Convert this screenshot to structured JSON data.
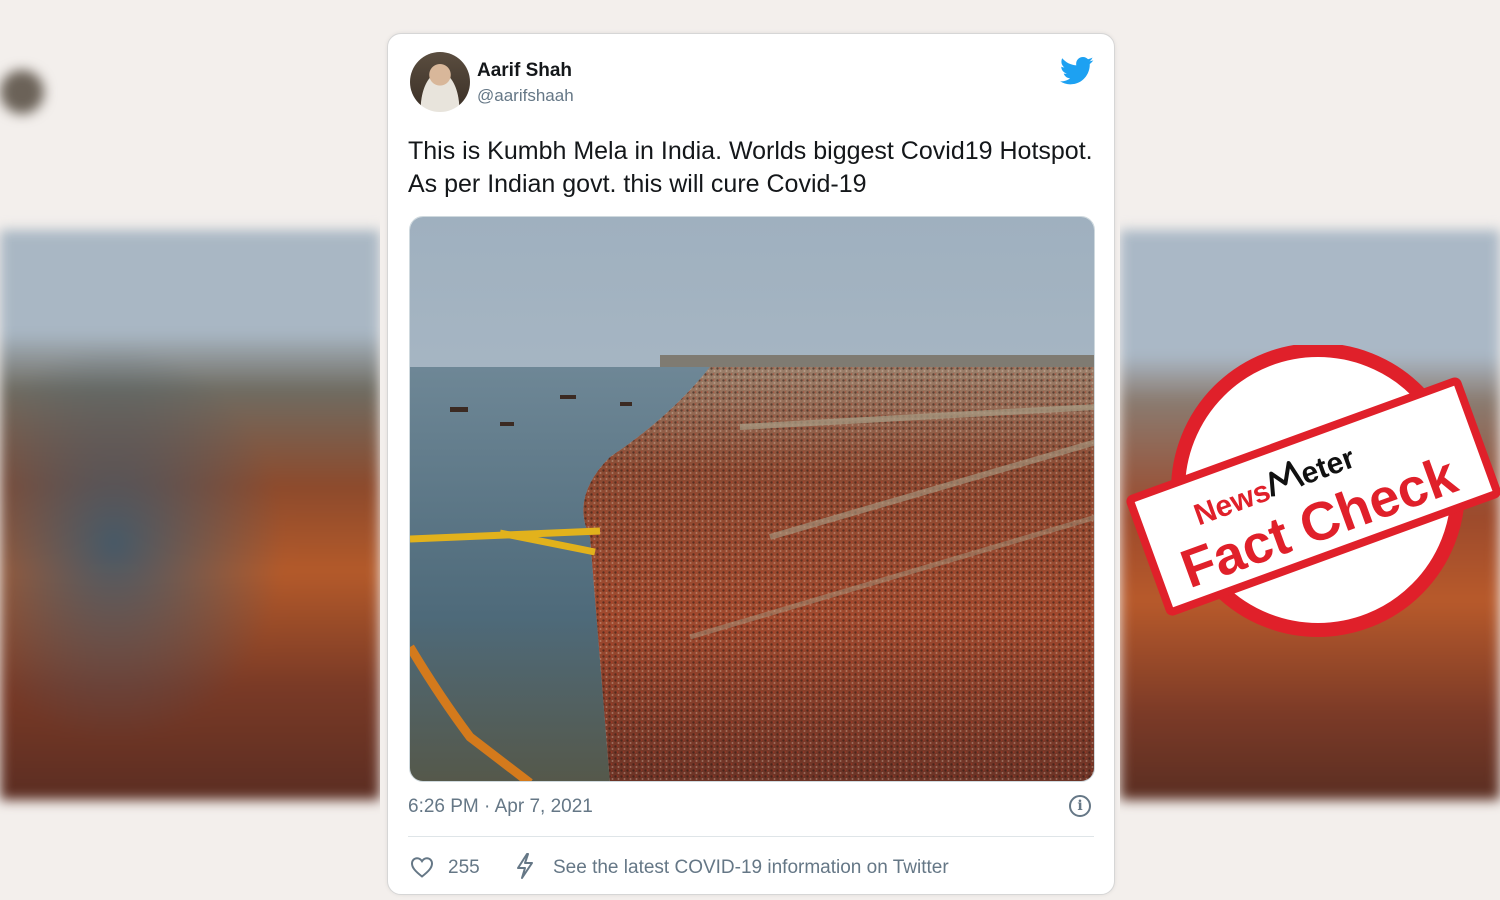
{
  "tweet": {
    "author_name": "Aarif Shah",
    "author_handle": "@aarifshaah",
    "text_line1": "This is Kumbh Mela in India. Worlds biggest Covid19 Hotspot.",
    "text_line2": "As per Indian govt. this will cure Covid-19",
    "timestamp": "6:26 PM · Apr 7, 2021",
    "like_count": "255",
    "covid_info_link": "See the latest COVID-19 information on Twitter",
    "icons": [
      "twitter-bird-icon",
      "info-icon",
      "heart-icon",
      "lightning-icon"
    ],
    "brand_color": "#1da1f2"
  },
  "stamp": {
    "brand_news": "News",
    "brand_meter": "eter",
    "label": "Fact Check",
    "color": "#e0202a"
  }
}
